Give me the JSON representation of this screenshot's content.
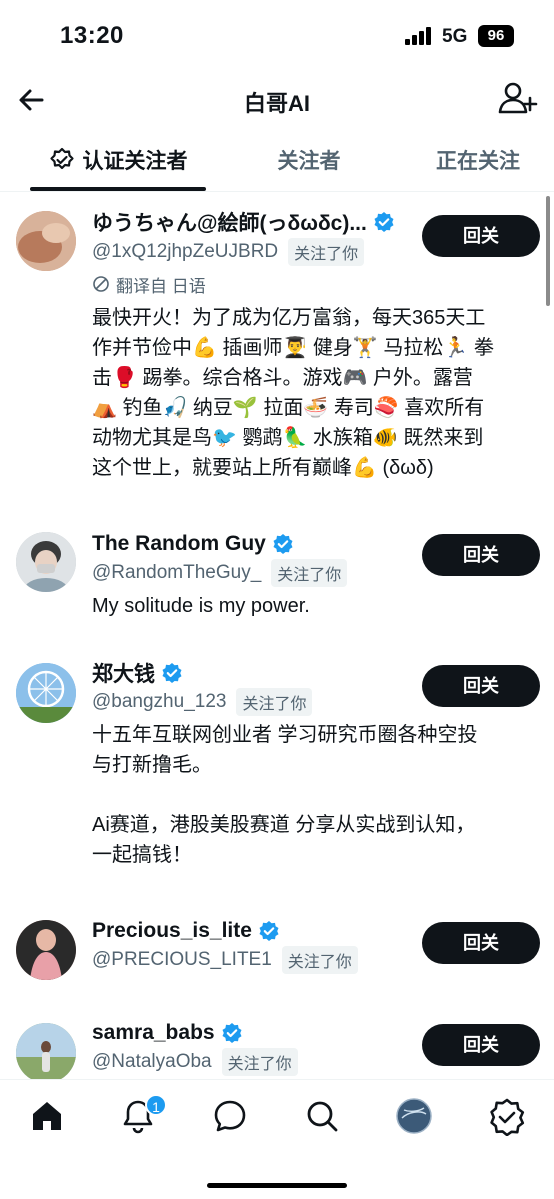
{
  "status": {
    "time": "13:20",
    "network": "5G",
    "battery": "96"
  },
  "header": {
    "title": "白哥AI"
  },
  "tabs": [
    {
      "label": "认证关注者",
      "active": true
    },
    {
      "label": "关注者",
      "active": false
    },
    {
      "label": "正在关注",
      "active": false
    }
  ],
  "users": [
    {
      "name": "ゆうちゃん@絵師(っδωδc)...",
      "handle": "@1xQ12jhpZeUJBRD",
      "follows_you": "关注了你",
      "translate_note": "翻译自 日语",
      "bio": "最快开火！为了成为亿万富翁，每天365天工\n作并节俭中💪 插画师👨‍🎓 健身🏋 马拉松🏃 拳\n击🥊 踢拳。综合格斗。游戏🎮 户外。露营\n⛺ 钓鱼🎣 纳豆🌱 拉面🍜 寿司🍣 喜欢所有\n动物尤其是鸟🐦 鹦鹉🦜 水族箱🐠 既然来到\n这个世上，就要站上所有巅峰💪 (δωδ)",
      "button": "回关",
      "avatar_color": "#c9967a"
    },
    {
      "name": "The Random Guy",
      "handle": "@RandomTheGuy_",
      "follows_you": "关注了你",
      "bio": "My solitude is my power.",
      "button": "回关",
      "avatar_color": "#b9c1c6"
    },
    {
      "name": "郑大钱",
      "handle": "@bangzhu_123",
      "follows_you": "关注了你",
      "bio": "十五年互联网创业者 学习研究币圈各种空投\n与打新撸毛。\n\nAi赛道，港股美股赛道 分享从实战到认知，\n一起搞钱！",
      "button": "回关",
      "avatar_color": "#7ab0dc"
    },
    {
      "name": "Precious_is_lite",
      "handle": "@PRECIOUS_LITE1",
      "follows_you": "关注了你",
      "bio": "",
      "button": "回关",
      "avatar_color": "#d99a94"
    },
    {
      "name": "samra_babs",
      "handle": "@NatalyaOba",
      "follows_you": "关注了你",
      "bio": "",
      "button": "回关",
      "avatar_color": "#8aa86a"
    }
  ],
  "bottom_nav": {
    "items": [
      "home-icon",
      "notifications-icon",
      "messages-icon",
      "search-icon",
      "grok-icon",
      "verified-icon"
    ],
    "notification_count": "1"
  },
  "colors": {
    "accent": "#1d9bf0",
    "button": "#0f1419",
    "muted": "#536471"
  }
}
